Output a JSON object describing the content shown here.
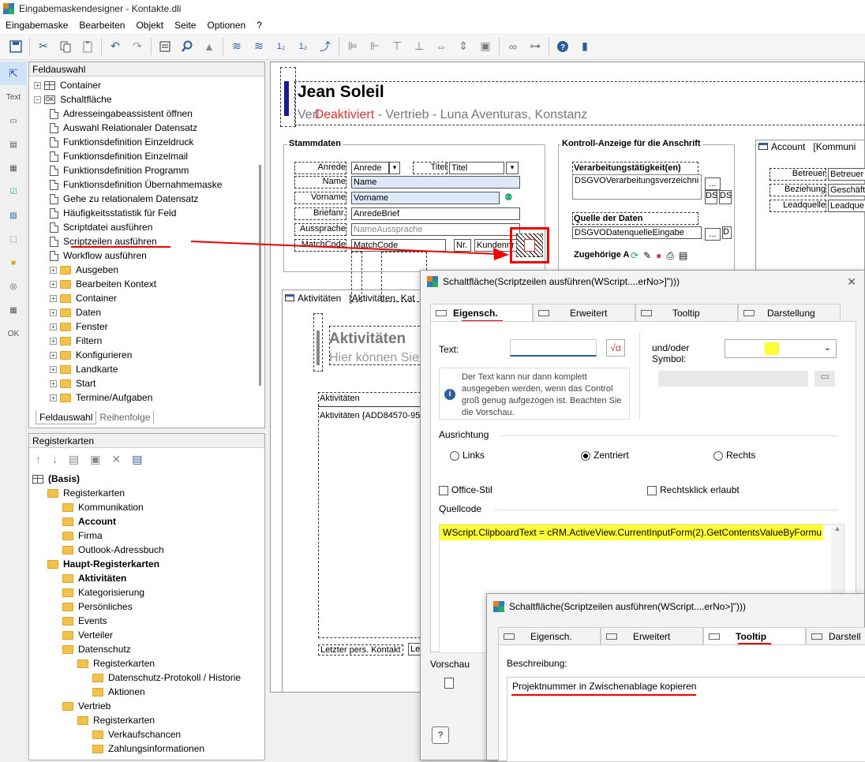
{
  "window": {
    "title": "Eingabemaskendesigner - Kontakte.dli"
  },
  "menu": [
    "Eingabemaske",
    "Bearbeiten",
    "Objekt",
    "Seite",
    "Optionen",
    "?"
  ],
  "toolbar": {
    "num1": "1₂",
    "num2": "1₂"
  },
  "leftbar": {
    "text_label": "Text",
    "ok_label": "OK"
  },
  "feldauswahl": {
    "title": "Feldauswahl",
    "items": [
      {
        "label": "Container",
        "level": 0,
        "type": "table",
        "exp": "+"
      },
      {
        "label": "Schaltfläche",
        "level": 0,
        "type": "ok",
        "exp": "-"
      },
      {
        "label": "Adresseingabeassistent öffnen",
        "level": 1,
        "type": "doc"
      },
      {
        "label": "Auswahl Relationaler Datensatz",
        "level": 1,
        "type": "doc"
      },
      {
        "label": "Funktionsdefinition Einzeldruck",
        "level": 1,
        "type": "doc"
      },
      {
        "label": "Funktionsdefinition Einzelmail",
        "level": 1,
        "type": "doc"
      },
      {
        "label": "Funktionsdefinition Programm",
        "level": 1,
        "type": "doc"
      },
      {
        "label": "Funktionsdefinition Übernahmemaske",
        "level": 1,
        "type": "doc"
      },
      {
        "label": "Gehe zu relationalem Datensatz",
        "level": 1,
        "type": "doc"
      },
      {
        "label": "Häufigkeitsstatistik für Feld",
        "level": 1,
        "type": "doc"
      },
      {
        "label": "Scriptdatei ausführen",
        "level": 1,
        "type": "doc"
      },
      {
        "label": "Scriptzeilen ausführen",
        "level": 1,
        "type": "doc"
      },
      {
        "label": "Workflow ausführen",
        "level": 1,
        "type": "doc"
      },
      {
        "label": "Ausgeben",
        "level": 1,
        "type": "folder",
        "exp": "+"
      },
      {
        "label": "Bearbeiten Kontext",
        "level": 1,
        "type": "folder",
        "exp": "+"
      },
      {
        "label": "Container",
        "level": 1,
        "type": "folder",
        "exp": "+"
      },
      {
        "label": "Daten",
        "level": 1,
        "type": "folder",
        "exp": "+"
      },
      {
        "label": "Fenster",
        "level": 1,
        "type": "folder",
        "exp": "+"
      },
      {
        "label": "Filtern",
        "level": 1,
        "type": "folder",
        "exp": "+"
      },
      {
        "label": "Konfigurieren",
        "level": 1,
        "type": "folder",
        "exp": "+"
      },
      {
        "label": "Landkarte",
        "level": 1,
        "type": "folder",
        "exp": "+"
      },
      {
        "label": "Start",
        "level": 1,
        "type": "folder",
        "exp": "+"
      },
      {
        "label": "Termine/Aufgaben",
        "level": 1,
        "type": "folder",
        "exp": "+"
      }
    ],
    "tabs": [
      "Feldauswahl",
      "Reihenfolge"
    ]
  },
  "registerkarten": {
    "title": "Registerkarten",
    "items": [
      {
        "label": "(Basis)",
        "level": 0,
        "bold": true,
        "type": "table"
      },
      {
        "label": "Registerkarten",
        "level": 1,
        "type": "folder"
      },
      {
        "label": "Kommunikation",
        "level": 2,
        "type": "folder"
      },
      {
        "label": "Account",
        "level": 2,
        "type": "folder",
        "bold": true
      },
      {
        "label": "Firma",
        "level": 2,
        "type": "folder"
      },
      {
        "label": "Outlook-Adressbuch",
        "level": 2,
        "type": "folder"
      },
      {
        "label": "Haupt-Registerkarten",
        "level": 1,
        "type": "folder",
        "bold": true
      },
      {
        "label": "Aktivitäten",
        "level": 2,
        "type": "folder",
        "bold": true
      },
      {
        "label": "Kategorisierung",
        "level": 2,
        "type": "folder"
      },
      {
        "label": "Persönliches",
        "level": 2,
        "type": "folder"
      },
      {
        "label": "Events",
        "level": 2,
        "type": "folder"
      },
      {
        "label": "Verteiler",
        "level": 2,
        "type": "folder"
      },
      {
        "label": "Datenschutz",
        "level": 2,
        "type": "folder"
      },
      {
        "label": "Registerkarten",
        "level": 3,
        "type": "folder"
      },
      {
        "label": "Datenschutz-Protokoll / Historie",
        "level": 4,
        "type": "folder"
      },
      {
        "label": "Aktionen",
        "level": 4,
        "type": "folder"
      },
      {
        "label": "Vertrieb",
        "level": 2,
        "type": "folder"
      },
      {
        "label": "Registerkarten",
        "level": 3,
        "type": "folder"
      },
      {
        "label": "Verkaufschancen",
        "level": 4,
        "type": "folder"
      },
      {
        "label": "Zahlungsinformationen",
        "level": 4,
        "type": "folder"
      }
    ]
  },
  "form": {
    "name": "Jean Soleil",
    "overlay_a": "Verl",
    "overlay_red": "Deaktiviert",
    "subtitle": " - Vertrieb - Luna Aventuras, Konstanz",
    "stammdaten": "Stammdaten",
    "labels": [
      "Anrede",
      "Name",
      "Vorname",
      "Briefanr.",
      "Aussprache",
      "MatchCode"
    ],
    "titel_label": "Titel",
    "fields": {
      "anrede": "Anrede",
      "titel": "Titel",
      "name": "Name",
      "vorname": "Vorname",
      "brief": "AnredeBrief",
      "aussprache": "NameAussprache",
      "matchcode": "MatchCode",
      "nr": "Nr.",
      "kunden": "Kundennr"
    },
    "kontroll": "Kontroll-Anzeige für die Anschrift",
    "verarb": "Verarbeitungstätigkeit(en)",
    "verarb_val": "DSGVOVerarbeitungsverzeichni",
    "quelle": "Quelle der Daten",
    "quelle_val": "DSGVODatenquelleEingabe",
    "zugehoerig": "Zugehörige A",
    "ds": "DS",
    "d": "D",
    "dots": "...",
    "account_tab": "Account",
    "account_tab2": "[Kommuni",
    "acc_labels": [
      "Betreuer",
      "Beziehung",
      "Leadquelle"
    ],
    "acc_vals": [
      "Betreuer",
      "Geschäft",
      "Leadque"
    ],
    "akt_tab": "Aktivitäten",
    "akt_tab2": "[Aktivitäten, Kat",
    "akt_title": "Aktivitäten",
    "akt_hint": "Hier können Sie",
    "akt_list_head": "Aktivitäten",
    "akt_list_val": "Aktivitäten {ADD84570-95",
    "letzter": "Letzter pers. Kontakt",
    "letzter_val": "Letz",
    "right_d": "D",
    "right_da": "Da"
  },
  "dialog1": {
    "title": "Schaltfläche(Scriptzeilen ausführen(WScript....erNo>]\")))",
    "tabs": [
      "Eigensch.",
      "Erweitert",
      "Tooltip",
      "Darstellung"
    ],
    "text_label": "Text:",
    "symbol_label": "und/oder\nSymbol:",
    "info": "Der Text kann nur dann komplett ausgegeben werden, wenn das Control groß genug aufgezogen ist. Beachten Sie die Vorschau.",
    "ausrichtung": "Ausrichtung",
    "radio": [
      "Links",
      "Zentriert",
      "Rechts"
    ],
    "office": "Office-Stil",
    "rechtsklick": "Rechtsklick erlaubt",
    "quellcode": "Quellcode",
    "code": "WScript.ClipboardText = cRM.ActiveView.CurrentInputForm(2).GetContentsValueByFormu",
    "vorschau": "Vorschau",
    "help": "?"
  },
  "dialog2": {
    "title": "Schaltfläche(Scriptzeilen ausführen(WScript....erNo>]\")))",
    "tabs": [
      "Eigensch.",
      "Erweitert",
      "Tooltip",
      "Darstell"
    ],
    "beschreibung": "Beschreibung:",
    "text": "Projektnummer in Zwischenablage kopieren"
  },
  "colors": {
    "highlight": "#ffff33",
    "red": "#e00000",
    "accent": "#1a1a8c"
  }
}
